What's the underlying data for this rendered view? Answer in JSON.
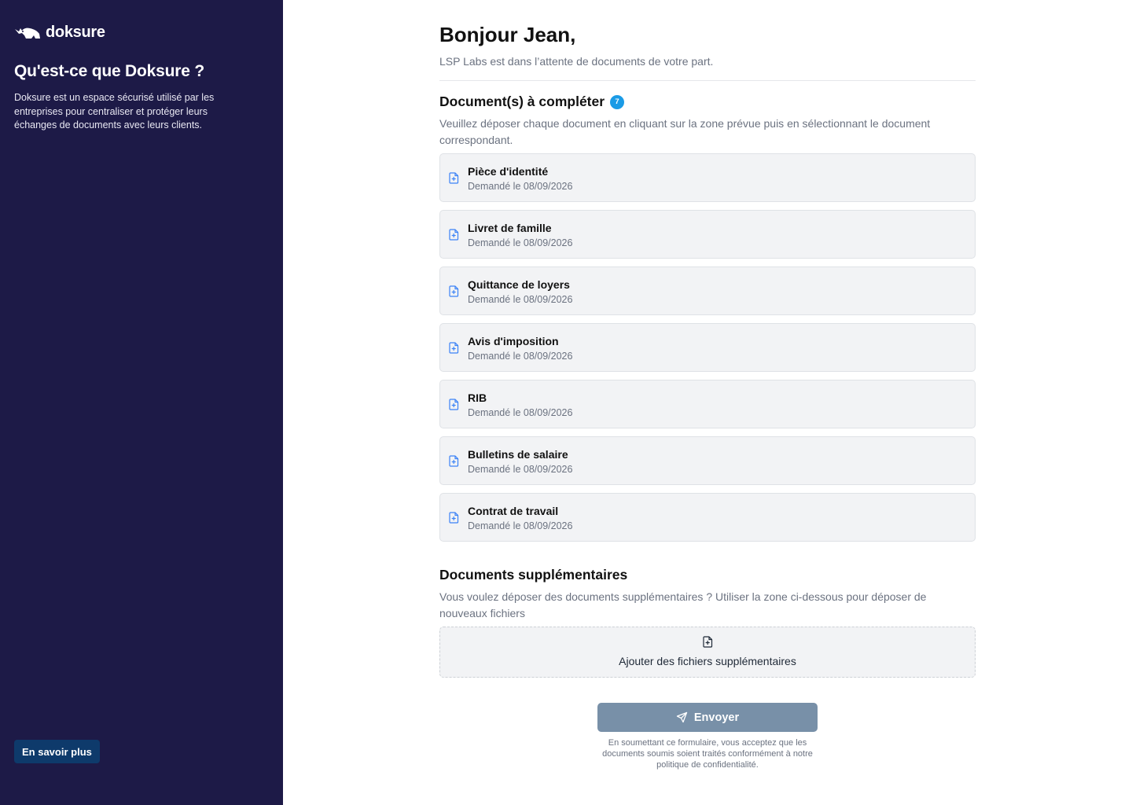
{
  "sidebar": {
    "brand": "doksure",
    "title": "Qu'est-ce que Doksure ?",
    "description": "Doksure est un espace sécurisé utilisé par les entreprises pour centraliser et protéger leurs échanges de documents avec leurs clients.",
    "learn_more_label": "En savoir plus",
    "background_color": "#1d1a47",
    "button_color": "#0e3a6b"
  },
  "main": {
    "greeting": "Bonjour Jean,",
    "subtitle": "LSP Labs est dans l’attente de documents de votre part.",
    "required": {
      "title": "Document(s) à compléter",
      "count": "7",
      "description": "Veuillez déposer chaque document en cliquant sur la zone prévue puis en sélectionnant le document correspondant.",
      "documents": [
        {
          "name": "Pièce d'identité",
          "requested": "Demandé le 08/09/2026"
        },
        {
          "name": "Livret de famille",
          "requested": "Demandé le 08/09/2026"
        },
        {
          "name": "Quittance de loyers",
          "requested": "Demandé le 08/09/2026"
        },
        {
          "name": "Avis d'imposition",
          "requested": "Demandé le 08/09/2026"
        },
        {
          "name": "RIB",
          "requested": "Demandé le 08/09/2026"
        },
        {
          "name": "Bulletins de salaire",
          "requested": "Demandé le 08/09/2026"
        },
        {
          "name": "Contrat de travail",
          "requested": "Demandé le 08/09/2026"
        }
      ]
    },
    "additional": {
      "title": "Documents supplémentaires",
      "description": "Vous voulez déposer des documents supplémentaires ? Utiliser la zone ci-dessous pour déposer de nouveaux fichiers",
      "dropzone_label": "Ajouter des fichiers supplémentaires"
    },
    "submit_label": "Envoyer",
    "legal": "En soumettant ce formulaire, vous acceptez que les documents soumis soient traités conformément à notre politique de confidentialité.",
    "colors": {
      "badge": "#1a9be6",
      "file_icon": "#3b82f6",
      "submit_disabled": "#7890a8"
    },
    "icons": {
      "document_item": "file-plus-icon",
      "dropzone": "file-plus-icon",
      "submit": "send-icon",
      "brand": "rhino-logo-icon"
    }
  }
}
